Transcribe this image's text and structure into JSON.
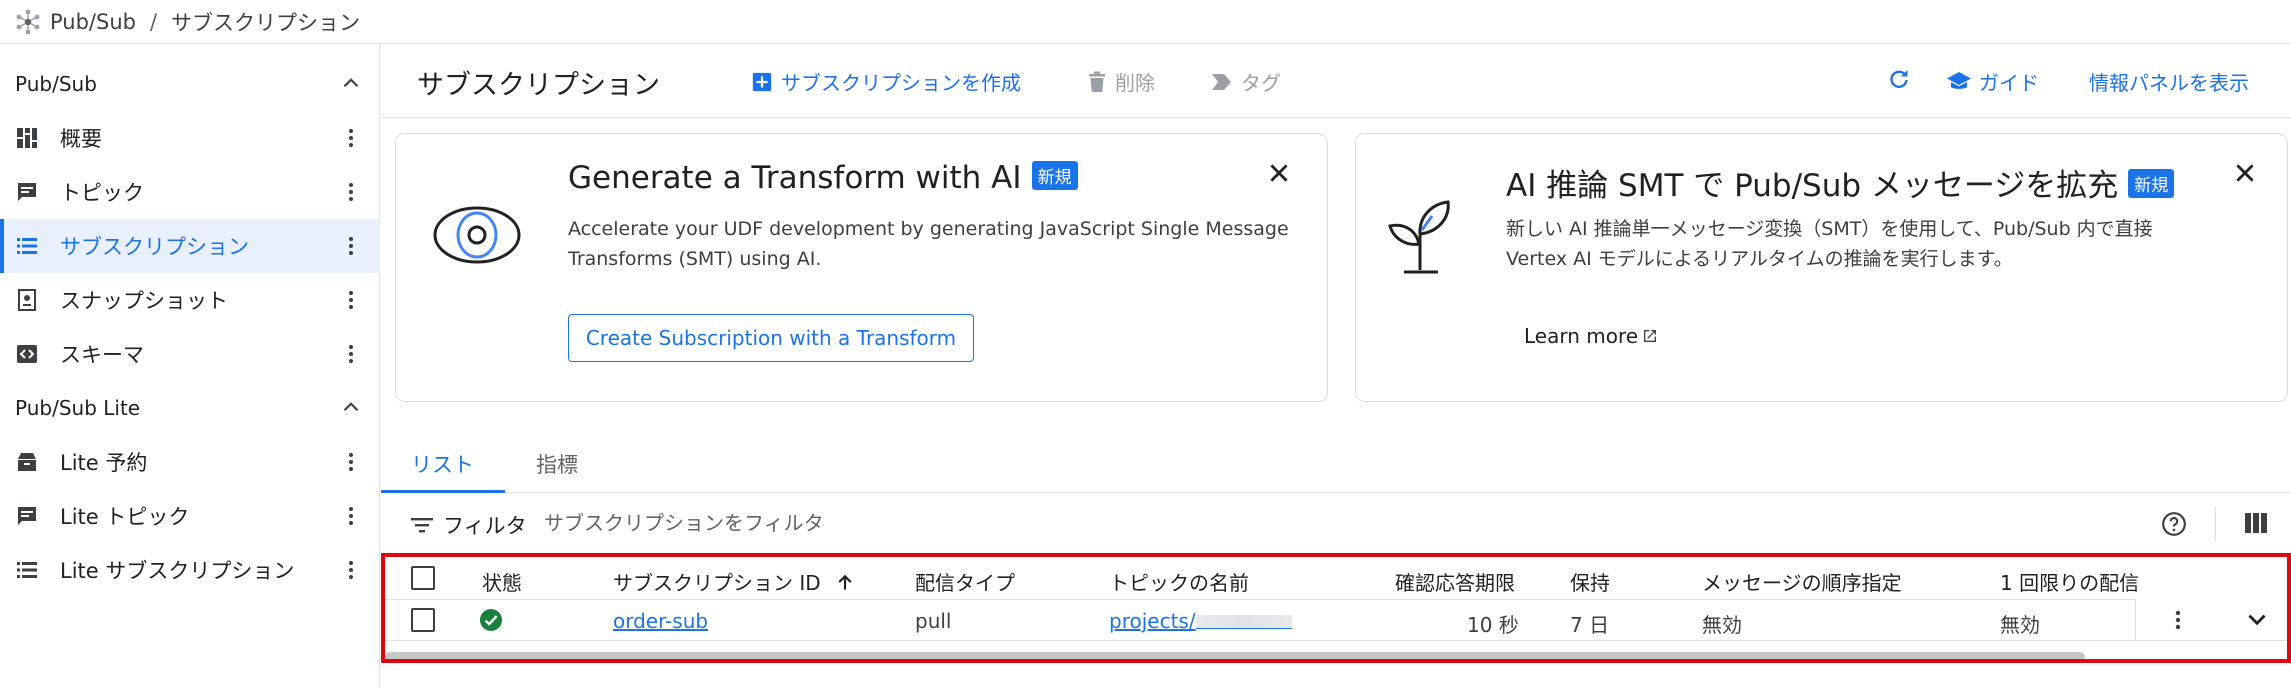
{
  "breadcrumb": {
    "root": "Pub/Sub",
    "separator": "/",
    "current": "サブスクリプション"
  },
  "sidebar": {
    "section1": "Pub/Sub",
    "items1": [
      {
        "label": "概要",
        "icon": "dashboard-icon"
      },
      {
        "label": "トピック",
        "icon": "topic-icon"
      },
      {
        "label": "サブスクリプション",
        "icon": "list-icon",
        "active": true
      },
      {
        "label": "スナップショット",
        "icon": "snapshot-icon"
      },
      {
        "label": "スキーマ",
        "icon": "schema-icon"
      }
    ],
    "section2": "Pub/Sub Lite",
    "items2": [
      {
        "label": "Lite 予約",
        "icon": "reservation-icon"
      },
      {
        "label": "Lite トピック",
        "icon": "topic-icon"
      },
      {
        "label": "Lite サブスクリプション",
        "icon": "list-icon"
      }
    ]
  },
  "toolbar": {
    "title": "サブスクリプション",
    "create": "サブスクリプションを作成",
    "delete": "削除",
    "tag": "タグ",
    "guide": "ガイド",
    "info_panel": "情報パネルを表示"
  },
  "card1": {
    "title": "Generate a Transform with AI",
    "badge": "新規",
    "desc1": "Accelerate your UDF development by generating JavaScript Single Message",
    "desc2": "Transforms (SMT) using AI.",
    "button": "Create Subscription with a Transform"
  },
  "card2": {
    "title": "AI 推論 SMT で Pub/Sub メッセージを拡充",
    "badge": "新規",
    "desc1": "新しい AI 推論単一メッセージ変換（SMT）を使用して、Pub/Sub 内で直接",
    "desc2": "Vertex AI モデルによるリアルタイムの推論を実行します。",
    "link": "Learn more"
  },
  "tabs": {
    "list": "リスト",
    "metrics": "指標"
  },
  "filter": {
    "label": "フィルタ",
    "placeholder": "サブスクリプションをフィルタ"
  },
  "table": {
    "headers": {
      "status": "状態",
      "id": "サブスクリプション ID",
      "delivery": "配信タイプ",
      "topic": "トピックの名前",
      "ack": "確認応答期限",
      "retention": "保持",
      "ordering": "メッセージの順序指定",
      "exactly_once": "1 回限りの配信"
    },
    "row": {
      "id": "order-sub",
      "delivery": "pull",
      "topic": "projects/",
      "ack": "10 秒",
      "retention": "7 日",
      "ordering": "無効",
      "exactly_once": "無効"
    }
  },
  "colors": {
    "accent": "#1a73e8",
    "success": "#188038",
    "highlight": "#e0060f"
  }
}
